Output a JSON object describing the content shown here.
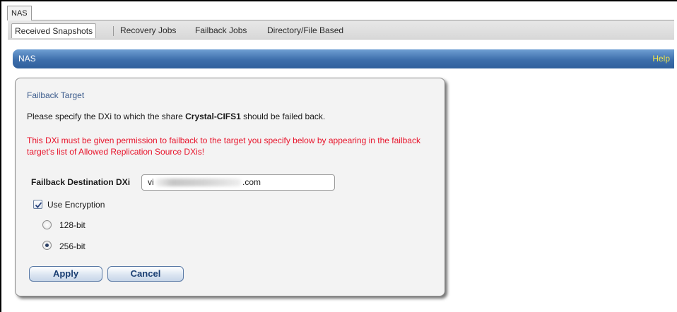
{
  "top_tabs": [
    {
      "label": "NAS"
    }
  ],
  "subnav": {
    "tabs": [
      {
        "label": "Received Snapshots",
        "active": true
      },
      {
        "label": "Recovery Jobs",
        "active": false
      },
      {
        "label": "Failback Jobs",
        "active": false
      },
      {
        "label": "Directory/File Based",
        "active": false
      }
    ]
  },
  "header": {
    "title": "NAS",
    "help_label": "Help"
  },
  "panel": {
    "title": "Failback Target",
    "instruction_before": "Please specify the DXi to which the share ",
    "share_name": "Crystal-CIFS1",
    "instruction_after": " should be failed back.",
    "warning": "This DXi must be given permission to failback to the target you specify below by appearing in the failback target's list of Allowed Replication Source DXis!",
    "destination_label": "Failback Destination DXi",
    "destination_value_prefix": "vi",
    "destination_value_suffix": ".com",
    "use_encryption_label": "Use Encryption",
    "use_encryption_checked": true,
    "encryption_options": [
      {
        "label": "128-bit",
        "selected": false
      },
      {
        "label": "256-bit",
        "selected": true
      }
    ],
    "apply_label": "Apply",
    "cancel_label": "Cancel"
  },
  "colors": {
    "header_blue": "#3d6eab",
    "help_yellow": "#f1e74a",
    "warning_red": "#e8142b",
    "panel_title_blue": "#3b5b8c"
  }
}
